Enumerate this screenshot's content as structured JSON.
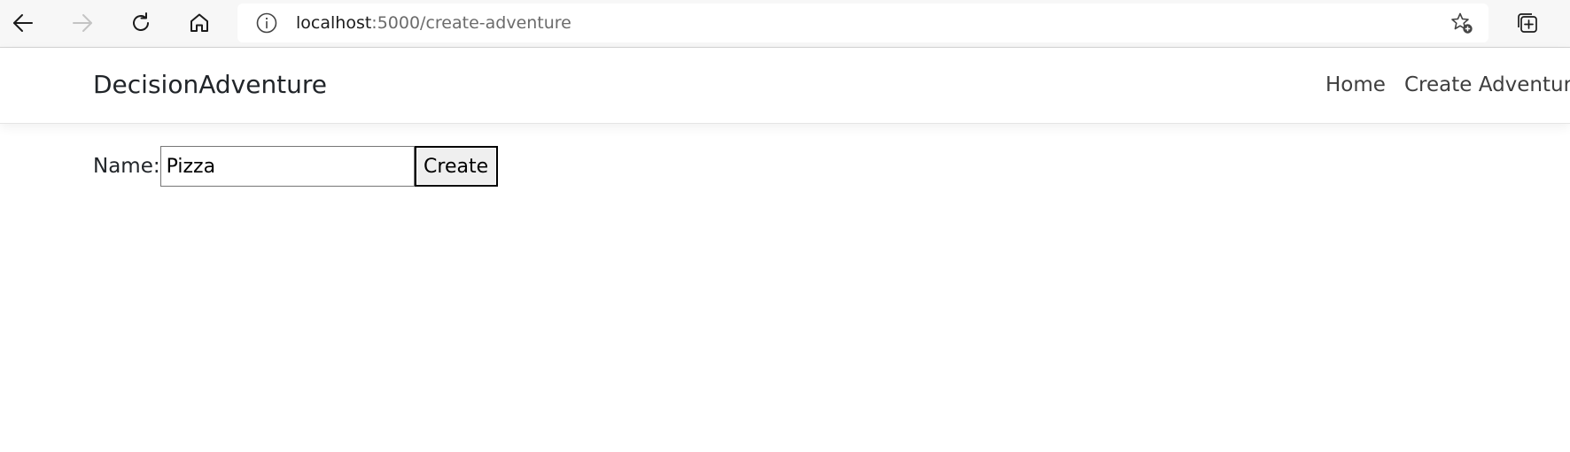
{
  "browser": {
    "url_host": "localhost",
    "url_rest": ":5000/create-adventure",
    "icons": {
      "back": "back-arrow-icon",
      "forward": "forward-arrow-icon",
      "refresh": "refresh-icon",
      "home": "home-icon",
      "site_info": "info-icon",
      "favorites": "add-favorite-star-icon",
      "collections": "collections-icon"
    }
  },
  "header": {
    "brand": "DecisionAdventure",
    "nav": [
      {
        "label": "Home"
      },
      {
        "label": "Create Adventure"
      }
    ]
  },
  "form": {
    "name_label": "Name:",
    "name_value": "Pizza",
    "create_label": "Create"
  }
}
